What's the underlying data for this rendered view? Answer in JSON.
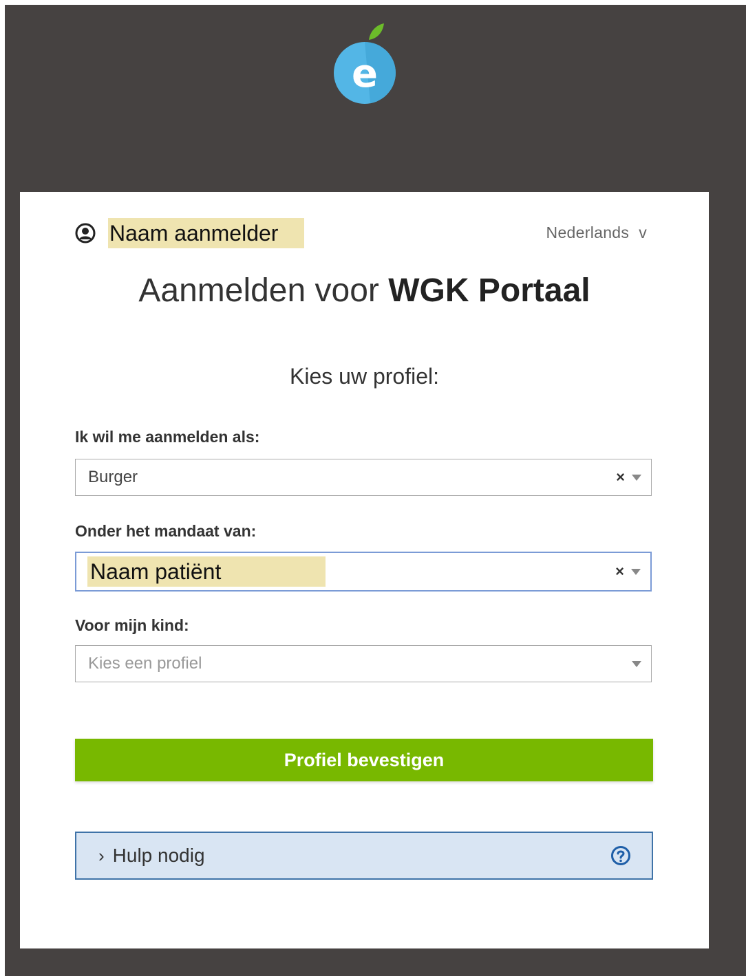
{
  "header": {
    "logo_letter": "e"
  },
  "user": {
    "name": "Naam aanmelder"
  },
  "language": {
    "label": "Nederlands",
    "caret": "v"
  },
  "title": {
    "prefix": "Aanmelden voor ",
    "app_name": "WGK Portaal"
  },
  "subtitle": "Kies uw profiel:",
  "fields": {
    "login_as": {
      "label": "Ik wil me aanmelden als:",
      "value": "Burger"
    },
    "mandate": {
      "label": "Onder het mandaat van:",
      "value": "Naam patiënt"
    },
    "child": {
      "label": "Voor mijn kind:",
      "placeholder": "Kies een profiel"
    }
  },
  "clear_symbol": "×",
  "confirm_button": "Profiel bevestigen",
  "help": {
    "chevron": "›",
    "label": "Hulp nodig"
  },
  "colors": {
    "background": "#464241",
    "accent_green": "#78b800",
    "help_border": "#3f73a8",
    "highlight": "#efe4b0"
  }
}
